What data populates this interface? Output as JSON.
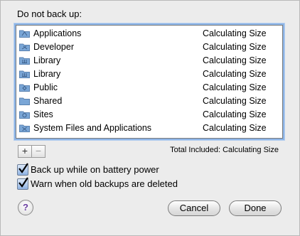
{
  "heading": "Do not back up:",
  "list": [
    {
      "name": "Applications",
      "size": "Calculating Size",
      "icon": "applications-folder-icon"
    },
    {
      "name": "Developer",
      "size": "Calculating Size",
      "icon": "developer-folder-icon"
    },
    {
      "name": "Library",
      "size": "Calculating Size",
      "icon": "library-folder-icon"
    },
    {
      "name": "Library",
      "size": "Calculating Size",
      "icon": "library-folder-icon"
    },
    {
      "name": "Public",
      "size": "Calculating Size",
      "icon": "public-folder-icon"
    },
    {
      "name": "Shared",
      "size": "Calculating Size",
      "icon": "folder-icon"
    },
    {
      "name": "Sites",
      "size": "Calculating Size",
      "icon": "sites-folder-icon"
    },
    {
      "name": "System Files and Applications",
      "size": "Calculating Size",
      "icon": "system-folder-icon"
    }
  ],
  "controls": {
    "add": "+",
    "remove": "−"
  },
  "total_included": "Total Included: Calculating Size",
  "options": {
    "battery": {
      "label": "Back up while on battery power",
      "checked": true
    },
    "warn": {
      "label": "Warn when old backups are deleted",
      "checked": true
    }
  },
  "help": "?",
  "buttons": {
    "cancel": "Cancel",
    "done": "Done"
  },
  "colors": {
    "folder": "#7aa6d6",
    "focus_ring": "#8cb4e6",
    "help_glyph": "#6a3ea1"
  }
}
